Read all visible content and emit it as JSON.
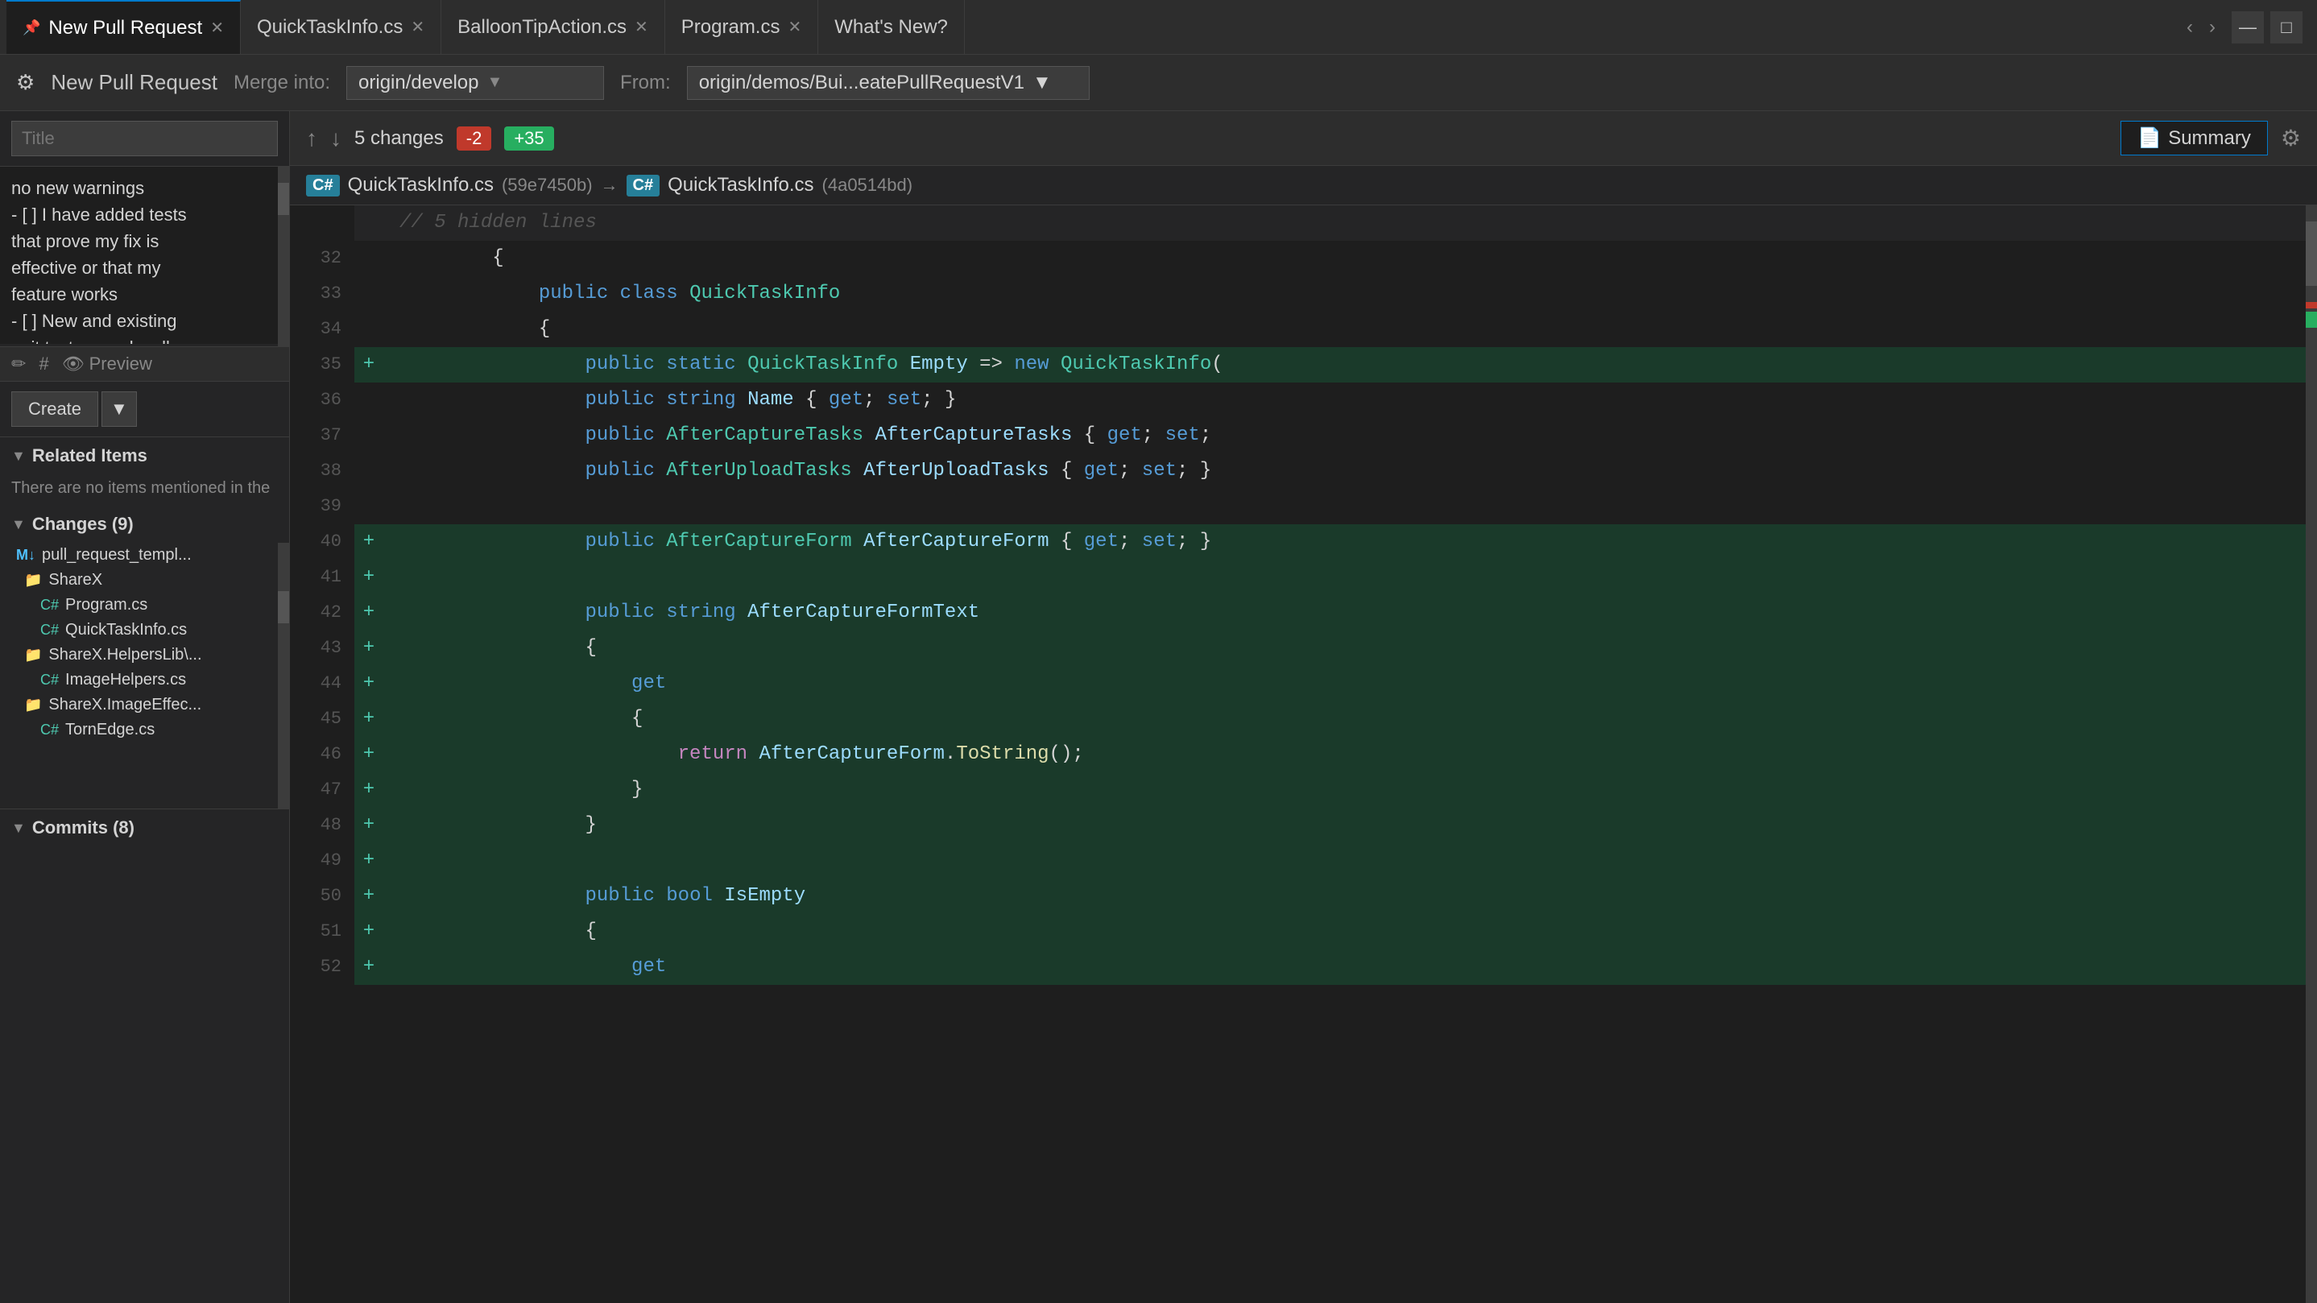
{
  "tabs": [
    {
      "label": "New Pull Request",
      "active": true,
      "pinned": true,
      "closable": true
    },
    {
      "label": "QuickTaskInfo.cs",
      "active": false,
      "closable": true
    },
    {
      "label": "BalloonTipAction.cs",
      "active": false,
      "closable": true
    },
    {
      "label": "Program.cs",
      "active": false,
      "closable": true
    },
    {
      "label": "What's New?",
      "active": false,
      "closable": false
    }
  ],
  "toolbar": {
    "icon": "⚙",
    "title": "New Pull Request",
    "merge_label": "Merge into:",
    "merge_value": "origin/develop",
    "from_label": "From:",
    "from_value": "origin/demos/Bui...eatePullRequestV1"
  },
  "left_panel": {
    "title_placeholder": "Title",
    "description": "no new warnings\n- [ ] I have added tests\nthat prove my fix is\neffective or that my\nfeature works\n- [ ] New and existing\nunit tests pass locally",
    "editor_tools": [
      {
        "icon": "✏",
        "label": ""
      },
      {
        "icon": "#",
        "label": ""
      },
      {
        "icon": "👁",
        "label": "Preview"
      }
    ],
    "create_btn": "Create",
    "related_items": {
      "header": "Related Items",
      "content": "There are no items mentioned in the"
    },
    "changes": {
      "header": "Changes (9)",
      "items": [
        {
          "indent": 0,
          "type": "md",
          "label": "pull_request_templ..."
        },
        {
          "indent": 1,
          "type": "folder",
          "label": "ShareX"
        },
        {
          "indent": 2,
          "type": "cs",
          "label": "Program.cs"
        },
        {
          "indent": 2,
          "type": "cs",
          "label": "QuickTaskInfo.cs"
        },
        {
          "indent": 1,
          "type": "folder",
          "label": "ShareX.HelpersLib\\..."
        },
        {
          "indent": 2,
          "type": "cs",
          "label": "ImageHelpers.cs"
        },
        {
          "indent": 1,
          "type": "folder",
          "label": "ShareX.ImageEffec..."
        },
        {
          "indent": 2,
          "type": "cs",
          "label": "TornEdge.cs"
        }
      ]
    },
    "commits": {
      "header": "Commits (8)"
    }
  },
  "diff_toolbar": {
    "changes_label": "5 changes",
    "removed": "-2",
    "added": "+35",
    "summary_label": "Summary",
    "summary_icon": "📄"
  },
  "diff_file_header": {
    "left_badge": "C#",
    "left_filename": "QuickTaskInfo.cs",
    "left_hash": "(59e7450b)",
    "arrow": "→",
    "right_badge": "C#",
    "right_filename": "QuickTaskInfo.cs",
    "right_hash": "(4a0514bd)"
  },
  "diff_lines": [
    {
      "num": "",
      "sign": "",
      "code": "    // 5 hidden lines",
      "type": "context"
    },
    {
      "num": "32",
      "sign": "",
      "code": "        {",
      "type": "neutral"
    },
    {
      "num": "33",
      "sign": "",
      "code": "            public class QuickTaskInfo",
      "type": "neutral"
    },
    {
      "num": "34",
      "sign": "",
      "code": "            {",
      "type": "neutral"
    },
    {
      "num": "35",
      "sign": "+",
      "code": "                public static QuickTaskInfo Empty => new QuickTaskInfo(",
      "type": "added"
    },
    {
      "num": "36",
      "sign": "",
      "code": "                public string Name { get; set; }",
      "type": "neutral"
    },
    {
      "num": "37",
      "sign": "",
      "code": "                public AfterCaptureTasks AfterCaptureTasks { get; set;",
      "type": "neutral"
    },
    {
      "num": "38",
      "sign": "",
      "code": "                public AfterUploadTasks AfterUploadTasks { get; set; }",
      "type": "neutral"
    },
    {
      "num": "39",
      "sign": "",
      "code": "",
      "type": "neutral"
    },
    {
      "num": "40",
      "sign": "+",
      "code": "                public AfterCaptureForm AfterCaptureForm { get; set; }",
      "type": "added"
    },
    {
      "num": "41",
      "sign": "+",
      "code": "",
      "type": "added"
    },
    {
      "num": "42",
      "sign": "+",
      "code": "                public string AfterCaptureFormText",
      "type": "added"
    },
    {
      "num": "43",
      "sign": "+",
      "code": "                {",
      "type": "added"
    },
    {
      "num": "44",
      "sign": "+",
      "code": "                    get",
      "type": "added"
    },
    {
      "num": "45",
      "sign": "+",
      "code": "                    {",
      "type": "added"
    },
    {
      "num": "46",
      "sign": "+",
      "code": "                        return AfterCaptureForm.ToString();",
      "type": "added"
    },
    {
      "num": "47",
      "sign": "+",
      "code": "                    }",
      "type": "added"
    },
    {
      "num": "48",
      "sign": "+",
      "code": "                }",
      "type": "added"
    },
    {
      "num": "49",
      "sign": "+",
      "code": "",
      "type": "added"
    },
    {
      "num": "50",
      "sign": "+",
      "code": "                public bool IsEmpty",
      "type": "added"
    },
    {
      "num": "51",
      "sign": "+",
      "code": "                {",
      "type": "added"
    },
    {
      "num": "52",
      "sign": "+",
      "code": "                    get",
      "type": "added"
    }
  ]
}
